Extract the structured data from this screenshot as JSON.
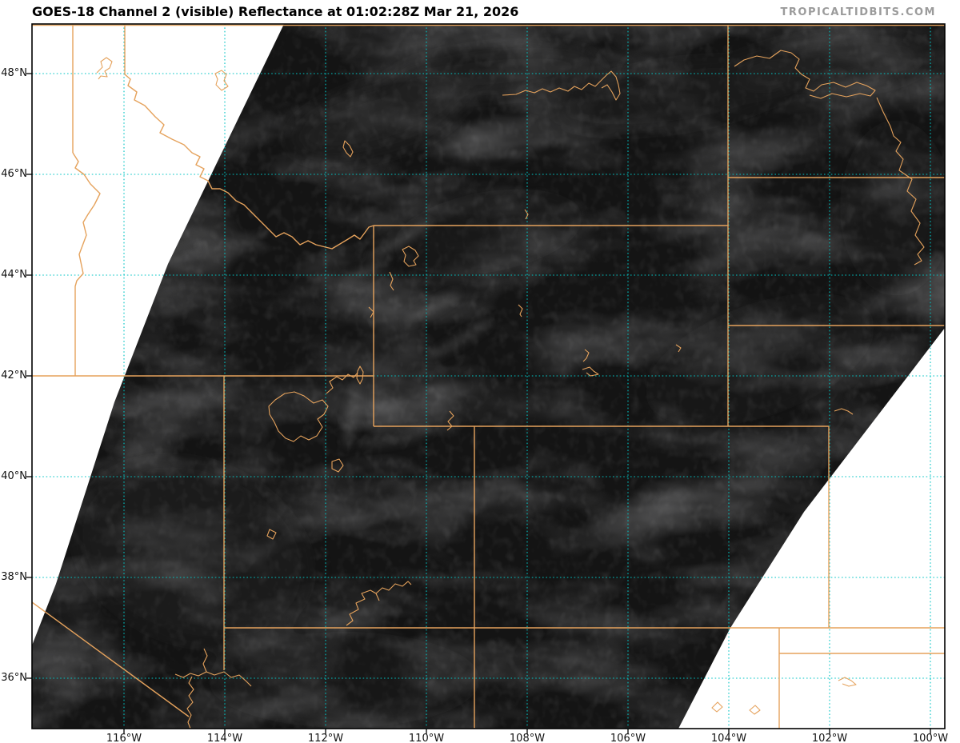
{
  "header": {
    "title": "GOES-18 Channel 2 (visible) Reflectance at 01:02:28Z Mar 21, 2026",
    "watermark": "TROPICALTIDBITS.COM"
  },
  "map": {
    "axes": {
      "lat_labels": [
        "48°N",
        "46°N",
        "44°N",
        "42°N",
        "40°N",
        "38°N",
        "36°N"
      ],
      "lon_labels": [
        "116°W",
        "114°W",
        "112°W",
        "110°W",
        "108°W",
        "106°W",
        "104°W",
        "102°W",
        "100°W"
      ]
    },
    "colors": {
      "grid": "#00c4c4",
      "state_border": "#e5a25c",
      "water_outline": "#e5a25c",
      "satellite_base": "#141414",
      "frame": "#000000",
      "title_text": "#000000",
      "watermark_text": "#9b9b9b",
      "background": "#ffffff"
    }
  }
}
